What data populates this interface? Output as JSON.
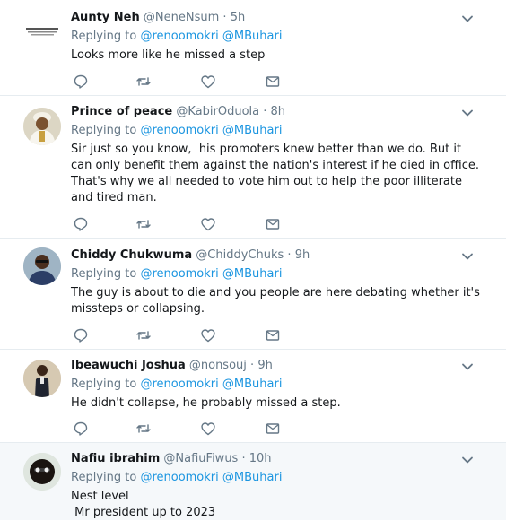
{
  "tweets": [
    {
      "name": "Aunty Neh",
      "handle": "@NeneNsum",
      "time": "5h",
      "replying_prefix": "Replying to",
      "mentions": [
        "@renoomokri",
        "@MBuhari"
      ],
      "text": "Looks more like he missed a step",
      "avatar": "avatar-text-image"
    },
    {
      "name": "Prince of peace",
      "handle": "@KabirOduola",
      "time": "8h",
      "replying_prefix": "Replying to",
      "mentions": [
        "@renoomokri",
        "@MBuhari"
      ],
      "text": "Sir just so you know,  his promoters knew better than we do. But it can only benefit them against the nation's interest if he died in office.\nThat's why we all needed to vote him out to help the poor illiterate and tired man.",
      "avatar": "avatar-man-white-cap"
    },
    {
      "name": "Chiddy Chukwuma",
      "handle": "@ChiddyChuks",
      "time": "9h",
      "replying_prefix": "Replying to",
      "mentions": [
        "@renoomokri",
        "@MBuhari"
      ],
      "text": "The guy is about to die and you people are here debating whether it's missteps or collapsing.",
      "avatar": "avatar-man-sunglasses"
    },
    {
      "name": "Ibeawuchi Joshua",
      "handle": "@nonsouj",
      "time": "9h",
      "replying_prefix": "Replying to",
      "mentions": [
        "@renoomokri",
        "@MBuhari"
      ],
      "text": "He didn't collapse, he probably missed a step.",
      "avatar": "avatar-man-standing"
    },
    {
      "name": "Nafiu ibrahim",
      "handle": "@NafiuFiwus",
      "time": "10h",
      "replying_prefix": "Replying to",
      "mentions": [
        "@renoomokri",
        "@MBuhari"
      ],
      "text": "Nest level\n Mr president up to 2023",
      "avatar": "avatar-dark-face"
    }
  ],
  "actions": [
    "reply-icon",
    "retweet-icon",
    "like-icon",
    "direct-message-icon"
  ],
  "colors": {
    "link": "#1b95e0",
    "muted": "#657786",
    "text": "#14171a",
    "highlight_bg": "#f5f8fa",
    "divider": "#e6ecf0"
  }
}
